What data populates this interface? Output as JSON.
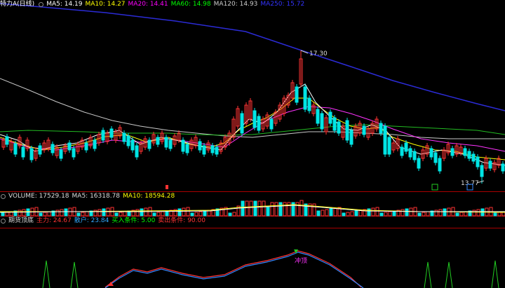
{
  "main_panel": {
    "title": "特力A(日线)",
    "indicators": [
      {
        "label": "MA5: 14.19",
        "color": "#ffffff"
      },
      {
        "label": "MA10: 14.27",
        "color": "#ffff00"
      },
      {
        "label": "MA20: 14.41",
        "color": "#ff00ff"
      },
      {
        "label": "MA60: 14.98",
        "color": "#00ff00"
      },
      {
        "label": "MA120: 14.93",
        "color": "#cccccc"
      },
      {
        "label": "MA250: 15.72",
        "color": "#3333ff"
      }
    ],
    "high_label": "17.30",
    "low_label": "13.77"
  },
  "volume_panel": {
    "indicators": [
      {
        "label": "VOLUME: 17529.18",
        "color": "#dddddd"
      },
      {
        "label": "MA5: 16318.78",
        "color": "#dddddd"
      },
      {
        "label": "MA10: 18594.28",
        "color": "#ffff00"
      }
    ]
  },
  "lower_panel": {
    "indicators": [
      {
        "label": "期货顶底",
        "color": "#dddddd"
      },
      {
        "label": "主力: 24.67",
        "color": "#ff3333"
      },
      {
        "label": "散户: 23.84",
        "color": "#33aaff"
      },
      {
        "label": "买入条件: 5.00",
        "color": "#00ff00"
      },
      {
        "label": "卖出条件: 90.00",
        "color": "#ff3333"
      }
    ],
    "annotation": "冲顶"
  },
  "colors": {
    "up": "#ff3333",
    "down": "#00e5e5",
    "background": "#000000"
  }
}
